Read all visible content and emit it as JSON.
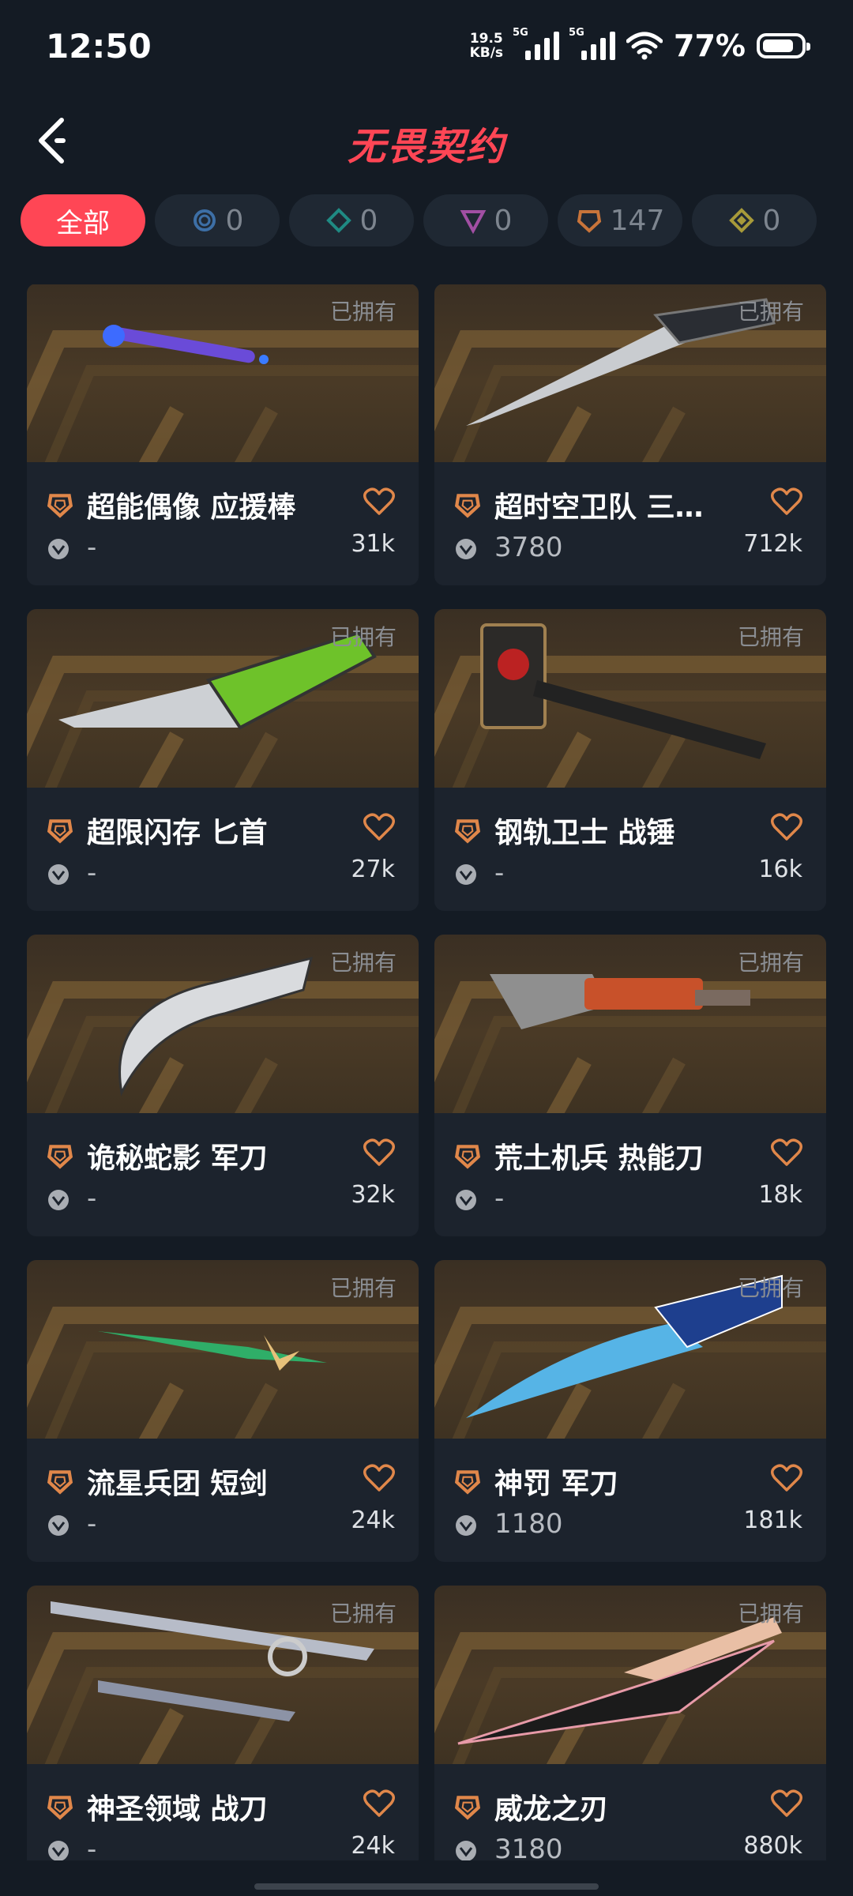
{
  "status": {
    "time": "12:50",
    "speed_value": "19.5",
    "speed_unit": "KB/s",
    "net1": "5G",
    "net2": "5G",
    "battery": "77%"
  },
  "header": {
    "title": "无畏契约"
  },
  "filters": [
    {
      "label": "全部",
      "active": true
    },
    {
      "icon": "circle-tier-icon",
      "count": "0",
      "color": "#3d6fa6"
    },
    {
      "icon": "diamond-tier-icon",
      "count": "0",
      "color": "#1f8a83"
    },
    {
      "icon": "triangle-tier-icon",
      "count": "0",
      "color": "#a14fa3"
    },
    {
      "icon": "pentagon-tier-icon",
      "count": "147",
      "color": "#c8743a"
    },
    {
      "icon": "rhombus-tier-icon",
      "count": "0",
      "color": "#a79a3a"
    }
  ],
  "owned_label": "已拥有",
  "items": [
    {
      "name": "超能偶像 应援棒",
      "price": "-",
      "count": "31k"
    },
    {
      "name": "超时空卫队 三…",
      "price": "3780",
      "count": "712k"
    },
    {
      "name": "超限闪存 匕首",
      "price": "-",
      "count": "27k"
    },
    {
      "name": "钢轨卫士 战锤",
      "price": "-",
      "count": "16k"
    },
    {
      "name": "诡秘蛇影 军刀",
      "price": "-",
      "count": "32k"
    },
    {
      "name": "荒土机兵 热能刀",
      "price": "-",
      "count": "18k"
    },
    {
      "name": "流星兵团 短剑",
      "price": "-",
      "count": "24k"
    },
    {
      "name": "神罚 军刀",
      "price": "1180",
      "count": "181k"
    },
    {
      "name": "神圣领域 战刀",
      "price": "-",
      "count": "24k"
    },
    {
      "name": "威龙之刃",
      "price": "3180",
      "count": "880k"
    }
  ],
  "colors": {
    "accent": "#ff4655",
    "tier": "#e0874a",
    "heart": "#e0874a"
  }
}
